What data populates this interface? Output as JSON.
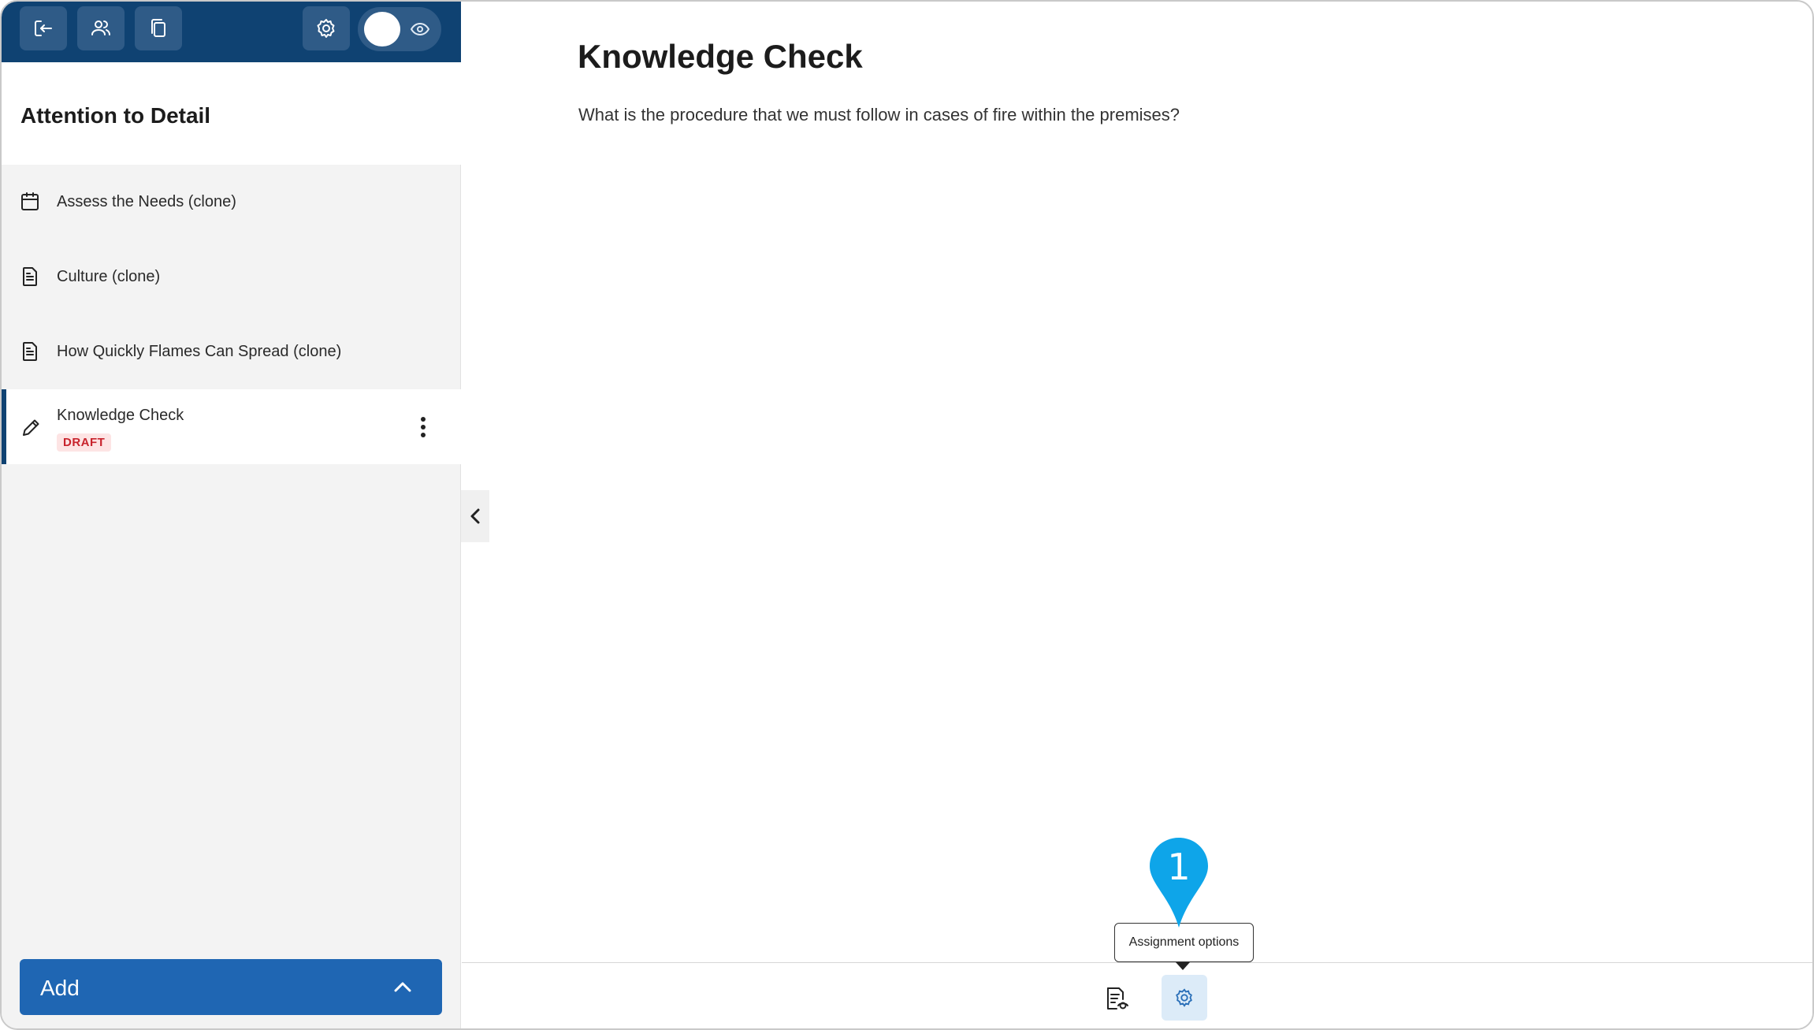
{
  "sidebar": {
    "course_title": "Attention to Detail",
    "items": [
      {
        "label": "Assess the Needs (clone)",
        "icon": "calendar-icon"
      },
      {
        "label": "Culture (clone)",
        "icon": "document-icon"
      },
      {
        "label": "How Quickly Flames Can Spread (clone)",
        "icon": "document-icon"
      },
      {
        "label": "Knowledge Check",
        "icon": "pencil-icon",
        "badge": "DRAFT",
        "active": true
      }
    ],
    "add_button": {
      "label": "Add"
    }
  },
  "main": {
    "title": "Knowledge Check",
    "question": "What is the procedure that we must follow in cases of fire within the premises?"
  },
  "footer": {
    "tooltip": "Assignment options"
  },
  "marker": {
    "number": "1",
    "color": "#0ea5e9"
  },
  "colors": {
    "topbar": "#0f4272",
    "accent": "#1f66b3",
    "draft_badge": "#c8232c"
  }
}
